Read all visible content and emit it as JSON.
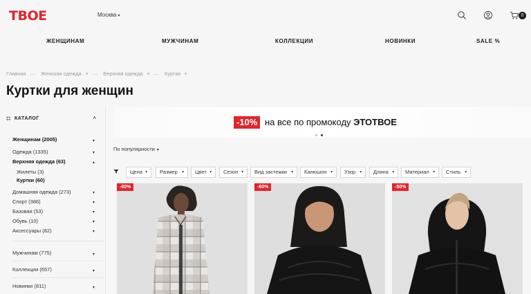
{
  "header": {
    "logo": "TBOE",
    "city": "Москва",
    "cart_count": "0",
    "icons": [
      "search-icon",
      "user-icon",
      "cart-icon"
    ]
  },
  "nav": [
    "ЖЕНЩИНАМ",
    "МУЖЧИНАМ",
    "КОЛЛЕКЦИИ",
    "НОВИНКИ",
    "SALE %"
  ],
  "breadcrumbs": [
    "Главная",
    "Женская одежда",
    "Верхняя одежда",
    "Куртки"
  ],
  "page_title": "Куртки для женщин",
  "sidebar": {
    "catalog_label": "КАТАЛОГ",
    "items": [
      {
        "label": "Женщинам (2005)"
      },
      {
        "label": "Одежда (1335)"
      },
      {
        "label": "Верхняя одежда (63)"
      },
      {
        "label": "Жилеты (3)"
      },
      {
        "label": "Куртки (60)"
      },
      {
        "label": "Домашняя одежда (273)"
      },
      {
        "label": "Спорт (386)"
      },
      {
        "label": "Базовая (53)"
      },
      {
        "label": "Обувь (10)"
      },
      {
        "label": "Аксессуары (82)"
      },
      {
        "label": "Мужчинам (775)"
      },
      {
        "label": "Коллекции (657)"
      },
      {
        "label": "Новинки (811)"
      }
    ]
  },
  "banner": {
    "discount": "-10%",
    "text": "на все по промокоду",
    "code": "ЭТОТВОЕ"
  },
  "sort_label": "По популярности",
  "filters": [
    "Цена",
    "Размер",
    "Цвет",
    "Сезон",
    "Вид застежки",
    "Капюшон",
    "Узор",
    "Длина",
    "Материал",
    "Стиль"
  ],
  "products": [
    {
      "discount": "-80%"
    },
    {
      "discount": "-60%"
    },
    {
      "discount": "-50%"
    }
  ],
  "colors": {
    "accent": "#e2242c",
    "text": "#1a1a1a",
    "background": "#f6f6f6"
  }
}
